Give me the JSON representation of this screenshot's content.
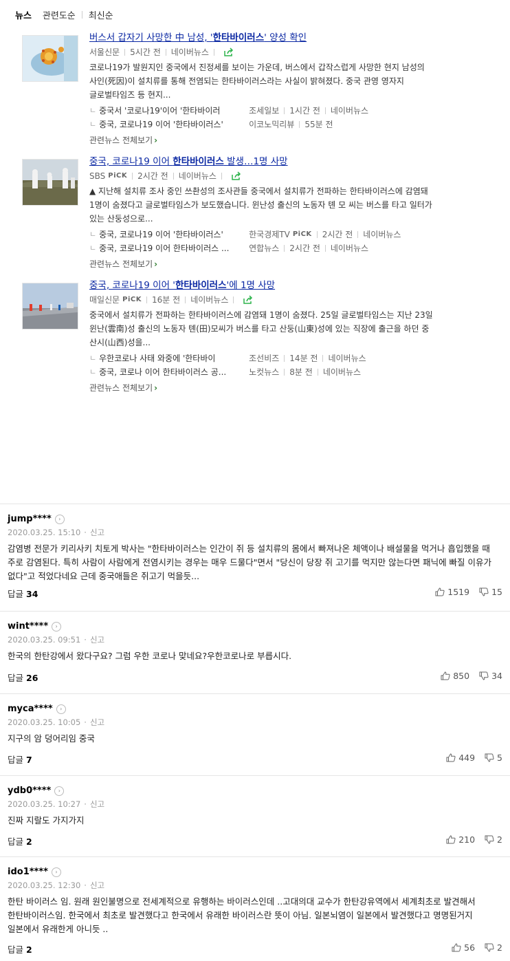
{
  "tabs": [
    {
      "label": "뉴스",
      "active": true
    },
    {
      "label": "관련도순",
      "active": false
    },
    {
      "label": "최신순",
      "active": false
    }
  ],
  "news": [
    {
      "title_pre": "버스서 갑자기 사망한 中 남성, '",
      "title_kw": "한타바이러스",
      "title_post": "' 양성 확인",
      "source": "서울신문",
      "pick": "",
      "time": "5시간 전",
      "portal": "네이버뉴스",
      "desc": "코로나19가 발원지인 중국에서 진정세를 보이는 가운데, 버스에서 갑작스럽게 사망한 현지 남성의 사인(死因)이 설치류를 통해 전염되는 한타바이러스라는 사실이 밝혀졌다. 중국 관영 영자지 글로벌타임즈 등 현지...",
      "related": [
        {
          "title": "중국서 '코로나19'이어 '한타바이러",
          "source": "조세일보",
          "pick": "",
          "time": "1시간 전",
          "portal": "네이버뉴스"
        },
        {
          "title": "중국, 코로나19 이어 '한타바이러스'",
          "source": "이코노믹리뷰",
          "pick": "",
          "time": "55분 전",
          "portal": ""
        }
      ],
      "more": "관련뉴스 전체보기"
    },
    {
      "title_pre": "중국, 코로나19 이어 ",
      "title_kw": "한타바이러스",
      "title_post": " 발생…1명 사망",
      "source": "SBS",
      "pick": "PiCK",
      "time": "2시간 전",
      "portal": "네이버뉴스",
      "desc": "▲ 지난해 설치류 조사 중인 쓰촨성의 조사관들 중국에서 설치류가 전파하는 한타바이러스에 감염돼 1명이 숨졌다고 글로벌타임스가 보도했습니다. 윈난성 출신의 노동자 톈 모 씨는 버스를 타고 일터가 있는 산둥성으로...",
      "related": [
        {
          "title": "중국, 코로나19 이어 '한타바이러스'",
          "source": "한국경제TV",
          "pick": "PiCK",
          "time": "2시간 전",
          "portal": "네이버뉴스"
        },
        {
          "title": "중국, 코로나19 이어 한타바이러스 ...",
          "source": "연합뉴스",
          "pick": "",
          "time": "2시간 전",
          "portal": "네이버뉴스"
        }
      ],
      "more": "관련뉴스 전체보기"
    },
    {
      "title_pre": "중국, 코로나19 이어 '",
      "title_kw": "한타바이러스",
      "title_post": "'에 1명 사망",
      "source": "매일신문",
      "pick": "PiCK",
      "time": "16분 전",
      "portal": "네이버뉴스",
      "desc": "중국에서 설치류가 전파하는 한타바이러스에 감염돼 1명이 숨졌다. 25일 글로벌타임스는 지난 23일 윈난(雲南)성 출신의 노동자 톈(田)모씨가 버스를 타고 산둥(山東)성에 있는 직장에 출근을 하던 중 산시(山西)성을...",
      "related": [
        {
          "title": "우한코로나 사태 와중에 '한타바이",
          "source": "조선비즈",
          "pick": "",
          "time": "14분 전",
          "portal": "네이버뉴스"
        },
        {
          "title": "중국, 코로나 이어 한타바이러스 공...",
          "source": "노컷뉴스",
          "pick": "",
          "time": "8분 전",
          "portal": "네이버뉴스"
        }
      ],
      "more": "관련뉴스 전체보기"
    }
  ],
  "comments": [
    {
      "user": "jump****",
      "date": "2020.03.25. 15:10",
      "report": "신고",
      "body": "감염병 전문가 키리사키 치토게 박사는 \"한타바이러스는 인간이 쥐 등 설치류의 몸에서 빠져나온 체액이나 배설물을 먹거나 흡입했을 때 주로 감염된다. 특히 사람이 사람에게 전염시키는 경우는 매우 드물다\"면서 \"당신이 당장 쥐 고기를 먹지만 않는다면 패닉에 빠질 이유가 없다\"고 적었다네요 근데 중국애들은 쥐고기 먹을듯...",
      "reply_label": "답글",
      "reply_count": "34",
      "likes": "1519",
      "dislikes": "15"
    },
    {
      "user": "wint****",
      "date": "2020.03.25. 09:51",
      "report": "신고",
      "body": "한국의 한탄강에서 왔다구요? 그럼 우한 코로나 맞네요?우한코로나로 부릅시다.",
      "reply_label": "답글",
      "reply_count": "26",
      "likes": "850",
      "dislikes": "34"
    },
    {
      "user": "myca****",
      "date": "2020.03.25. 10:05",
      "report": "신고",
      "body": "지구의 암 덩어리임 중국",
      "reply_label": "답글",
      "reply_count": "7",
      "likes": "449",
      "dislikes": "5"
    },
    {
      "user": "ydb0****",
      "date": "2020.03.25. 10:27",
      "report": "신고",
      "body": "진짜 지랄도 가지가지",
      "reply_label": "답글",
      "reply_count": "2",
      "likes": "210",
      "dislikes": "2"
    },
    {
      "user": "ido1****",
      "date": "2020.03.25. 12:30",
      "report": "신고",
      "body": "한탄 바이러스 임. 원래 원인불명으로 전세계적으로 유행하는 바이러스인데 ..고대의대 교수가 한탄강유역에서 세계최초로 발견해서 한탄바이러스임. 한국에서 최초로 발견했다고 한국에서 유래한 바이러스란 뜻이 아님. 일본뇌염이 일본에서 발견했다고 명명된거지 일본에서 유래한게 아니듯 ..",
      "reply_label": "답글",
      "reply_count": "2",
      "likes": "56",
      "dislikes": "2"
    }
  ]
}
